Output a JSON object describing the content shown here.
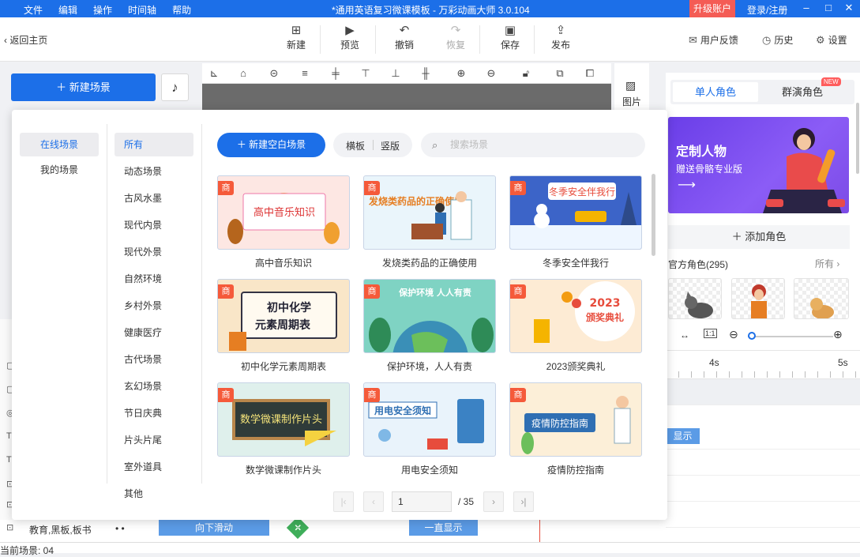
{
  "menu": [
    "文件",
    "编辑",
    "操作",
    "时间轴",
    "帮助"
  ],
  "app_title": "*通用英语复习微课模板 - 万彩动画大师 3.0.104",
  "upgrade_label": "升级账户",
  "login_label": "登录/注册",
  "window_btns": {
    "min": "–",
    "max": "□",
    "close": "✕"
  },
  "toolbar": {
    "back": "返回主页",
    "new": "新建",
    "preview": "预览",
    "undo": "撤销",
    "redo": "恢复",
    "save": "保存",
    "publish": "发布",
    "feedback": "用户反馈",
    "history": "历史",
    "settings": "设置"
  },
  "left": {
    "new_scene": "新建场景"
  },
  "image_tool": "图片",
  "right_panel": {
    "tab_single": "单人角色",
    "tab_group": "群演角色",
    "new_badge": "NEW",
    "banner_title": "定制人物",
    "banner_sub": "赠送骨骼专业版",
    "add_role": "添加角色",
    "official": "官方角色(295)",
    "all": "所有"
  },
  "timeline": {
    "ruler": [
      "4s",
      "5s"
    ],
    "clip_show1": "显示",
    "clip_slide": "向下滑动",
    "clip_show2": "一直显示",
    "row_label": "教育,黑板,板书",
    "dots": "•   •",
    "current_scene": "当前场景: 04"
  },
  "popup": {
    "sources": [
      "在线场景",
      "我的场景"
    ],
    "categories": [
      "所有",
      "动态场景",
      "古风水墨",
      "现代内景",
      "现代外景",
      "自然环境",
      "乡村外景",
      "健康医疗",
      "古代场景",
      "玄幻场景",
      "节日庆典",
      "片头片尾",
      "室外道具",
      "其他"
    ],
    "new_blank": "新建空白场景",
    "orient_h": "横板",
    "orient_v": "竖版",
    "search_placeholder": "搜索场景",
    "shang": "商",
    "cards": [
      {
        "label": "高中音乐知识",
        "art": "高中音乐知识"
      },
      {
        "label": "发烧类药品的正确使用",
        "art": "发烧类药品的正确使用"
      },
      {
        "label": "冬季安全伴我行",
        "art": "冬季安全伴我行"
      },
      {
        "label": "初中化学元素周期表",
        "art": "初中化学元素周期表"
      },
      {
        "label": "保护环境，人人有责",
        "art": "保护环境 人人有责"
      },
      {
        "label": "2023颁奖典礼",
        "art": "2023颁奖典礼"
      },
      {
        "label": "数学微课制作片头",
        "art": "数学微课制作片头"
      },
      {
        "label": "用电安全须知",
        "art": "用电安全须知"
      },
      {
        "label": "疫情防控指南",
        "art": "疫情防控指南"
      }
    ],
    "page_current": "1",
    "page_total": "/ 35"
  }
}
